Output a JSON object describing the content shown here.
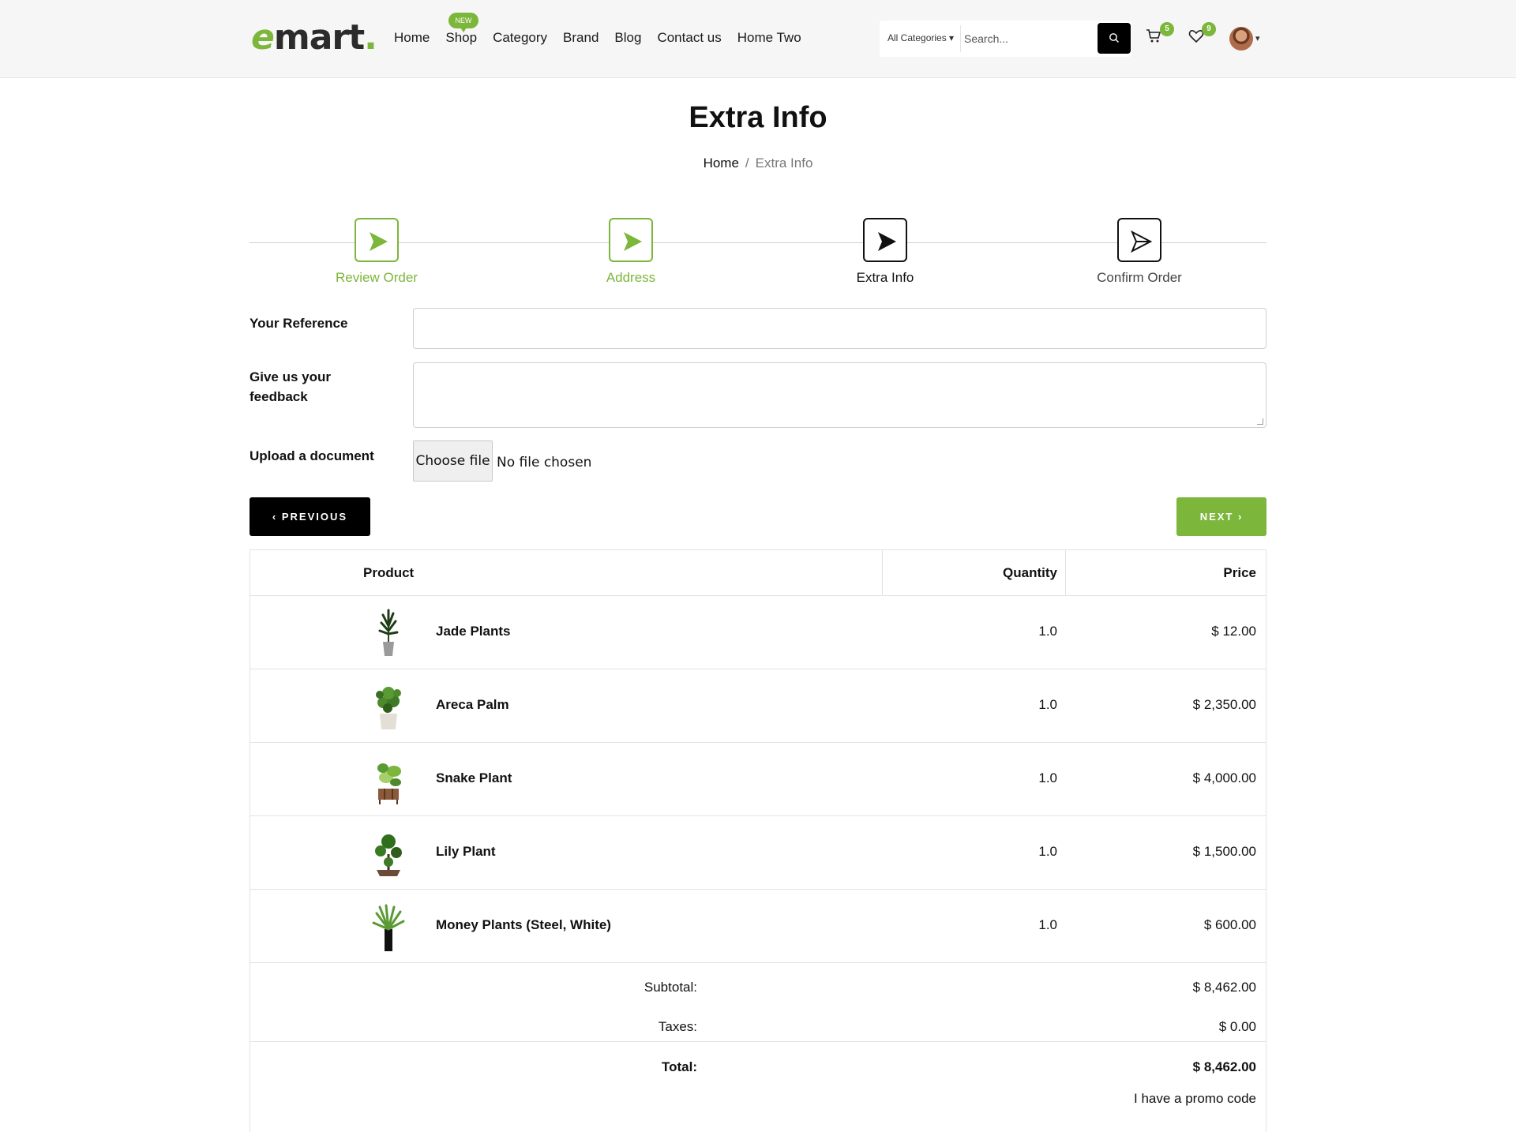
{
  "header": {
    "logo": {
      "e": "e",
      "rest": "mart",
      "dot": "."
    },
    "nav": [
      "Home",
      "Shop",
      "Category",
      "Brand",
      "Blog",
      "Contact us",
      "Home Two"
    ],
    "new_badge": "NEW",
    "search": {
      "category": "All Categories",
      "placeholder": "Search..."
    },
    "cart_count": "5",
    "wishlist_count": "9",
    "colors": {
      "accent": "#7cb63a",
      "dark": "#000000"
    }
  },
  "page": {
    "title": "Extra Info",
    "breadcrumb": {
      "home": "Home",
      "separator": "/",
      "current": "Extra Info"
    }
  },
  "stepper": [
    {
      "label": "Review Order",
      "state": "done"
    },
    {
      "label": "Address",
      "state": "done"
    },
    {
      "label": "Extra Info",
      "state": "active"
    },
    {
      "label": "Confirm Order",
      "state": "pending"
    }
  ],
  "form": {
    "reference_label": "Your Reference",
    "reference_value": "",
    "feedback_label_1": "Give us your",
    "feedback_label_2": "feedback",
    "feedback_value": "",
    "upload_label": "Upload a document",
    "choose_file": "Choose file",
    "file_status": "No file chosen",
    "previous": "PREVIOUS",
    "next": "NEXT"
  },
  "table": {
    "headers": {
      "product": "Product",
      "quantity": "Quantity",
      "price": "Price"
    },
    "rows": [
      {
        "name": "Jade Plants",
        "qty": "1.0",
        "price": "$ 12.00",
        "icon": "jade-plant-image"
      },
      {
        "name": "Areca Palm",
        "qty": "1.0",
        "price": "$ 2,350.00",
        "icon": "areca-palm-image"
      },
      {
        "name": "Snake Plant",
        "qty": "1.0",
        "price": "$ 4,000.00",
        "icon": "snake-plant-image"
      },
      {
        "name": "Lily Plant",
        "qty": "1.0",
        "price": "$ 1,500.00",
        "icon": "lily-plant-image"
      },
      {
        "name": "Money Plants (Steel, White)",
        "qty": "1.0",
        "price": "$ 600.00",
        "icon": "money-plant-image"
      }
    ],
    "subtotal_label": "Subtotal:",
    "subtotal": "$ 8,462.00",
    "taxes_label": "Taxes:",
    "taxes": "$ 0.00",
    "total_label": "Total:",
    "total": "$ 8,462.00",
    "promo": "I have a promo code"
  }
}
